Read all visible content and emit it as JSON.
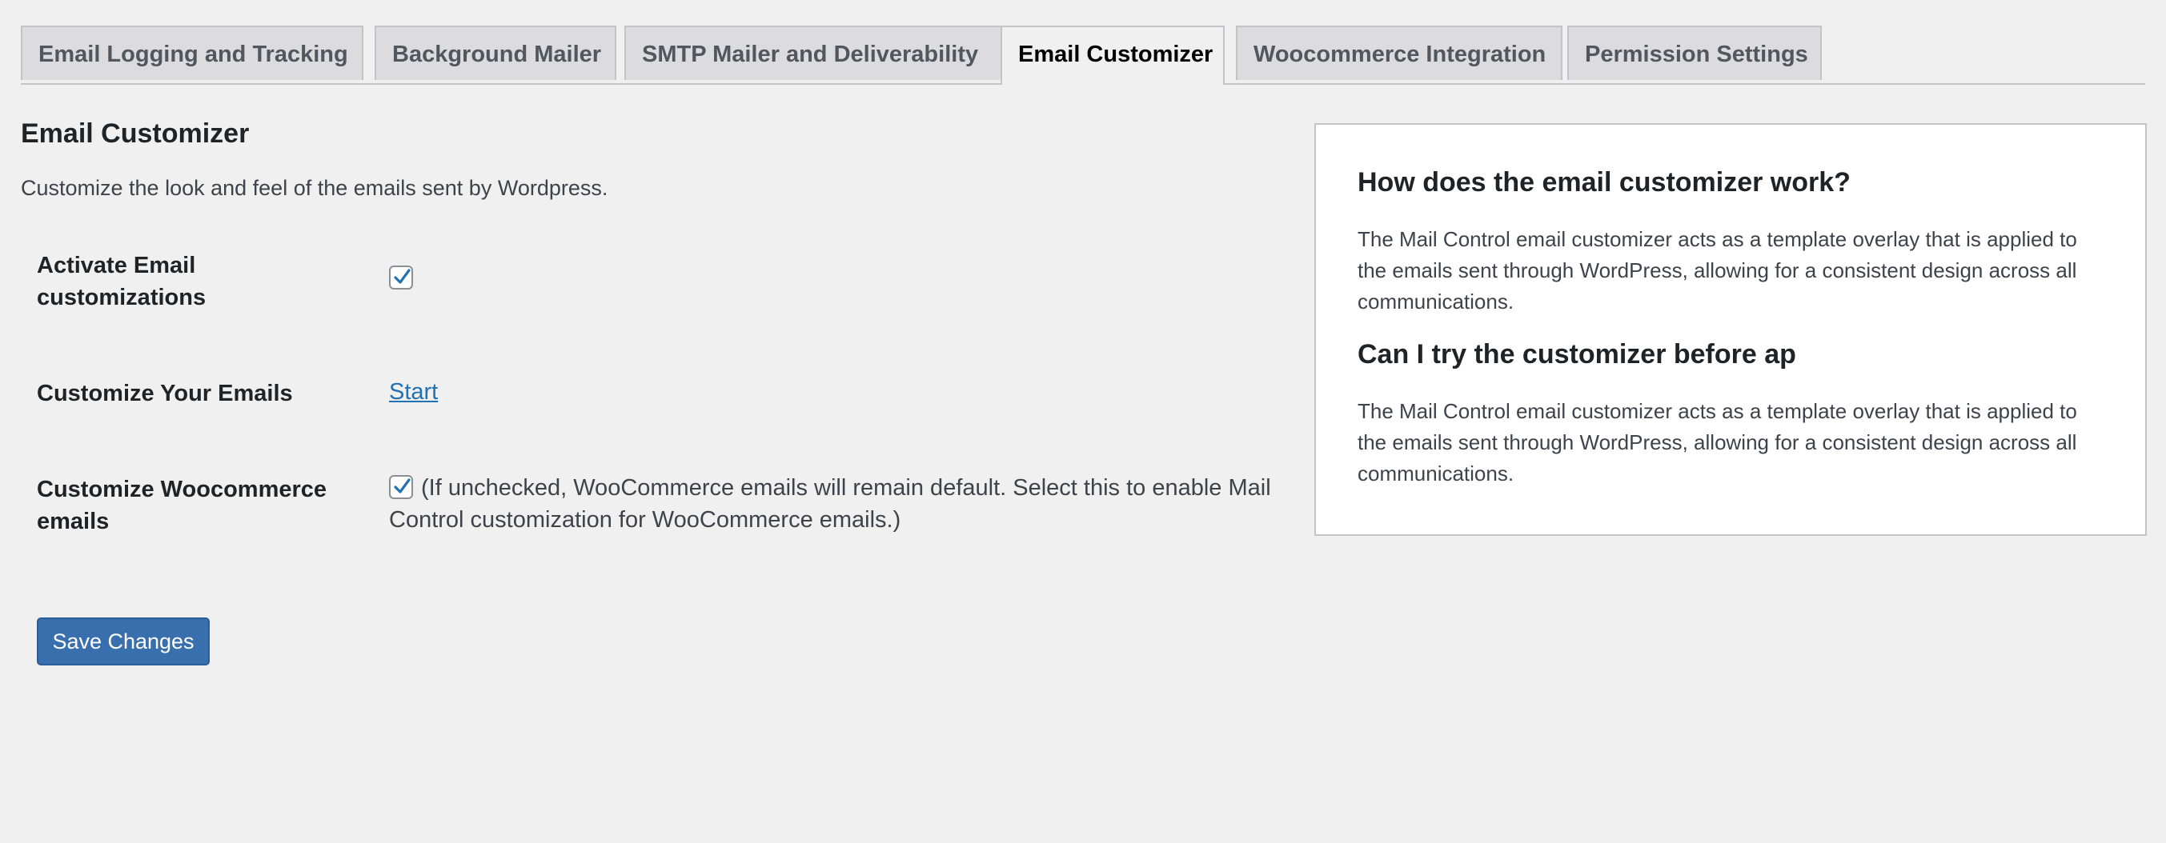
{
  "tabs": [
    {
      "label": "Email Logging and Tracking",
      "active": false
    },
    {
      "label": "Background Mailer",
      "active": false
    },
    {
      "label": "SMTP Mailer and Deliverability",
      "active": false
    },
    {
      "label": "Email Customizer",
      "active": true
    },
    {
      "label": "Woocommerce Integration",
      "active": false
    },
    {
      "label": "Permission Settings",
      "active": false
    }
  ],
  "section": {
    "title": "Email Customizer",
    "description": "Customize the look and feel of the emails sent by Wordpress."
  },
  "settings": {
    "activate_label": "Activate Email customizations",
    "activate_checked": true,
    "customize_label": "Customize Your Emails",
    "customize_link": "Start",
    "woo_label": "Customize Woocommerce emails",
    "woo_checked": true,
    "woo_description": "(If unchecked, WooCommerce emails will remain default. Select this to enable Mail Control customization for WooCommerce emails.)"
  },
  "save_button": "Save Changes",
  "info": {
    "q1": "How does the email customizer work?",
    "a1": "The Mail Control email customizer acts as a template overlay that is applied to the emails sent through WordPress, allowing for a consistent design across all communications.",
    "q2": "Can I try the customizer before ap",
    "a2": "The Mail Control email customizer acts as a template overlay that is applied to the emails sent through WordPress, allowing for a consistent design across all communications."
  },
  "colors": {
    "background": "#f0f0f1",
    "accent": "#2271b1",
    "button": "#3a6fae"
  }
}
